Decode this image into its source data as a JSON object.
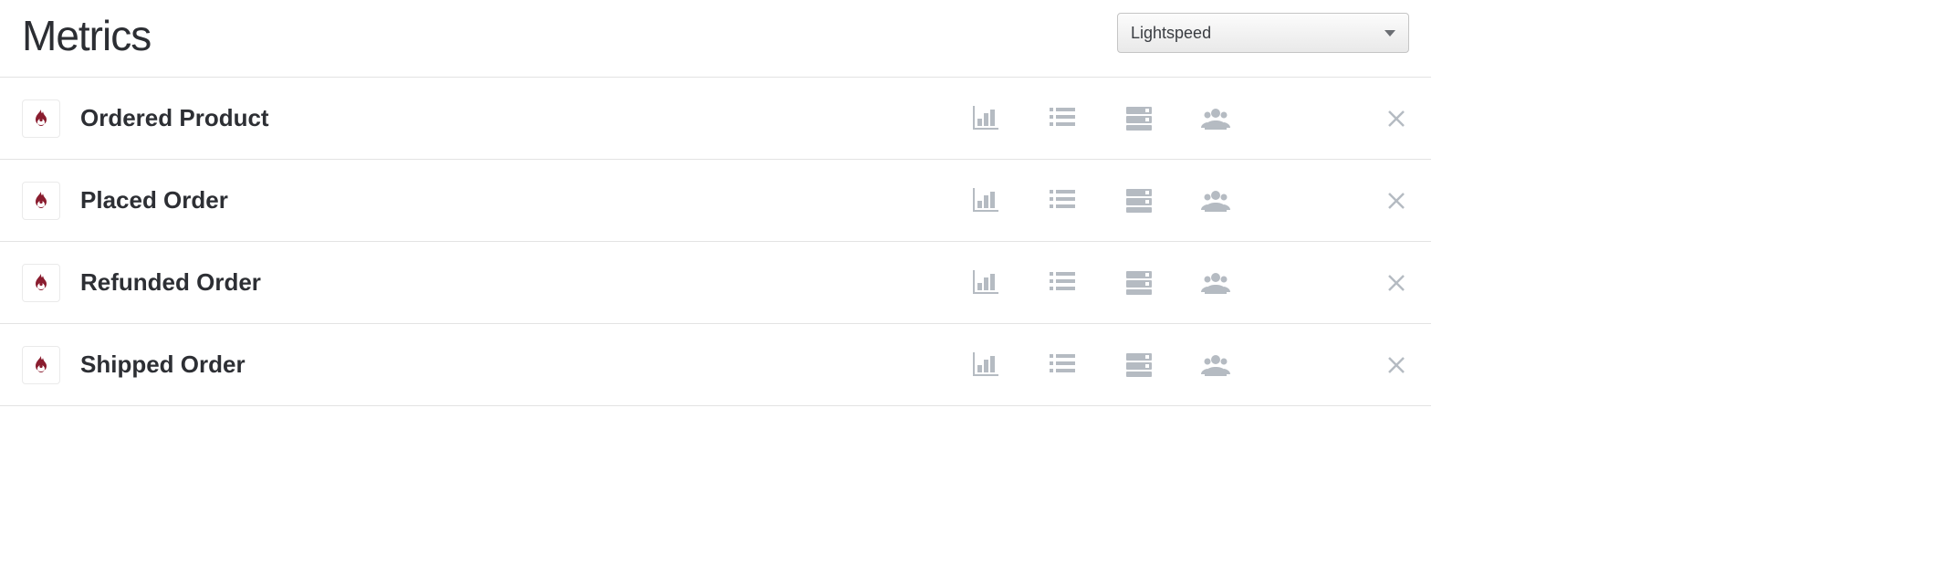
{
  "header": {
    "title": "Metrics",
    "filter_selected": "Lightspeed"
  },
  "metrics": [
    {
      "source_icon": "lightspeed-flame-icon",
      "name": "Ordered Product"
    },
    {
      "source_icon": "lightspeed-flame-icon",
      "name": "Placed Order"
    },
    {
      "source_icon": "lightspeed-flame-icon",
      "name": "Refunded Order"
    },
    {
      "source_icon": "lightspeed-flame-icon",
      "name": "Shipped Order"
    }
  ],
  "row_actions": {
    "chart": "chart-icon",
    "activity": "list-icon",
    "feed": "server-icon",
    "cohort": "people-icon",
    "delete": "close-icon"
  },
  "colors": {
    "icon_gray": "#b5bbc2",
    "brand_red": "#8a1d2f"
  }
}
